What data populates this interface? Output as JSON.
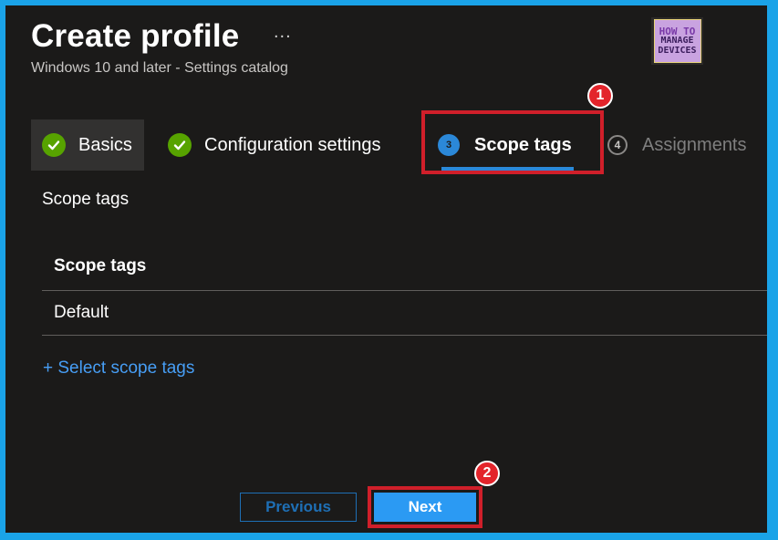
{
  "header": {
    "title": "Create profile",
    "more_label": "...",
    "subtitle": "Windows 10 and later - Settings catalog"
  },
  "logo": {
    "line1": "HOW TO",
    "line2": "MANAGE",
    "line3": "DEVICES"
  },
  "tabs": [
    {
      "label": "Basics",
      "state": "complete",
      "icon": "check-icon"
    },
    {
      "label": "Configuration settings",
      "state": "complete",
      "icon": "check-icon"
    },
    {
      "label": "Scope tags",
      "state": "active",
      "number": "3"
    },
    {
      "label": "Assignments",
      "state": "upcoming",
      "number": "4"
    }
  ],
  "annotations": {
    "badge1": "1",
    "badge2": "2"
  },
  "content": {
    "section_label": "Scope tags",
    "table": {
      "header": "Scope tags",
      "rows": [
        "Default"
      ]
    },
    "select_link": "+ Select scope tags"
  },
  "footer": {
    "previous_label": "Previous",
    "next_label": "Next"
  },
  "colors": {
    "background": "#1b1a19",
    "accent": "#2b88d8",
    "success": "#57a300",
    "highlight": "#d01f2a",
    "frame": "#1aa3e8"
  }
}
